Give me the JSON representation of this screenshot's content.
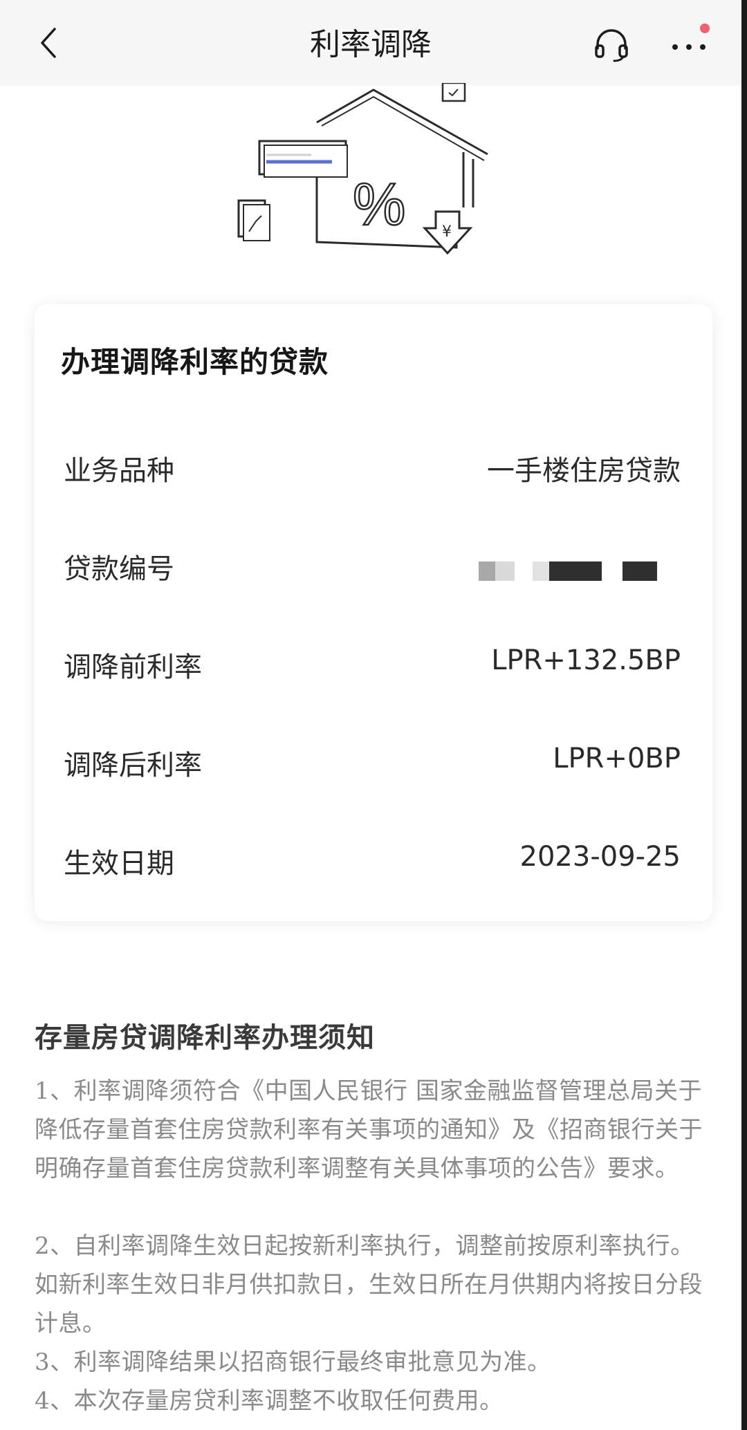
{
  "header": {
    "title": "利率调降"
  },
  "icons": {
    "back": "chevron-left-icon",
    "service": "headset-icon",
    "more": "more-dots-icon",
    "hero": "house-percent-illustration"
  },
  "colors": {
    "notify_dot": "#f0606f",
    "accent_bar": "#5b6fd6"
  },
  "loan_card": {
    "title": "办理调降利率的贷款",
    "rows": [
      {
        "label": "业务品种",
        "value": "一手楼住房贷款"
      },
      {
        "label": "贷款编号",
        "value": ""
      },
      {
        "label": "调降前利率",
        "value": "LPR+132.5BP"
      },
      {
        "label": "调降后利率",
        "value": "LPR+0BP"
      },
      {
        "label": "生效日期",
        "value": "2023-09-25"
      }
    ]
  },
  "notice": {
    "title": "存量房贷调降利率办理须知",
    "items": [
      {
        "num": "1",
        "sep": "、",
        "text": "利率调降须符合《中国人民银行 国家金融监督管理总局关于降低存量首套住房贷款利率有关事项的通知》及《招商银行关于明确存量首套住房贷款利率调整有关具体事项的公告》要求。"
      },
      {
        "num": "2",
        "sep": "、",
        "text": "自利率调降生效日起按新利率执行，调整前按原利率执行。如新利率生效日非月供扣款日，生效日所在月供期内将按日分段计息。"
      },
      {
        "num": "3",
        "sep": "、",
        "text": "利率调降结果以招商银行最终审批意见为准。"
      },
      {
        "num": "4",
        "sep": "、",
        "text": "本次存量房贷利率调整不收取任何费用。"
      }
    ]
  }
}
